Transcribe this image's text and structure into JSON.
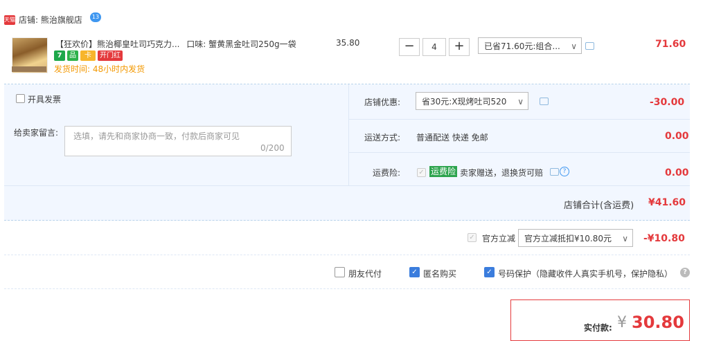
{
  "shop": {
    "logo_text": "天猫",
    "label": "店铺: 熊治旗舰店",
    "chat_badge": "13"
  },
  "item": {
    "title": "【狂欢价】熊治椰皇吐司巧克力...",
    "flavor": "口味: 蟹黄黑金吐司250g一袋",
    "badges": [
      "7",
      "品",
      "卡",
      "开门红"
    ],
    "ship_time": "发货时间: 48小时内发货",
    "unit_price": "35.80",
    "qty_minus": "−",
    "qty_value": "4",
    "qty_plus": "+",
    "promo_select": "已省71.60元:组合...",
    "subtotal": "71.60"
  },
  "panel": {
    "invoice_label": "开具发票",
    "message_label": "给卖家留言:",
    "message_placeholder": "选填，请先和商家协商一致，付款后商家可见",
    "message_count": "0/200",
    "shop_discount_label": "店铺优惠:",
    "shop_discount_select": "省30元:X现烤吐司520",
    "shop_discount_value": "-30.00",
    "shipping_label": "运送方式:",
    "shipping_text": "普通配送 快递 免邮",
    "shipping_value": "0.00",
    "insurance_label": "运费险:",
    "insurance_tag": "运费险",
    "insurance_text": "卖家赠送，退换货可赔",
    "insurance_value": "0.00",
    "shop_total_label": "店铺合计(含运费)",
    "shop_total_value": "¥41.60"
  },
  "official": {
    "label": "官方立减",
    "select": "官方立减抵扣¥10.80元",
    "value": "-¥10.80"
  },
  "options": {
    "friend_pay": "朋友代付",
    "anonymous": "匿名购买",
    "number_protect": "号码保护（隐藏收件人真实手机号，保护隐私）",
    "help": "?"
  },
  "payment": {
    "label": "实付款:",
    "currency": "¥",
    "amount": "30.80"
  },
  "colors": {
    "accent_red": "#e4393c",
    "panel_bg": "#f2f7ff",
    "checkbox_blue": "#3b7ddd",
    "orange_text": "#f39800",
    "green_tag": "#2da44e"
  }
}
